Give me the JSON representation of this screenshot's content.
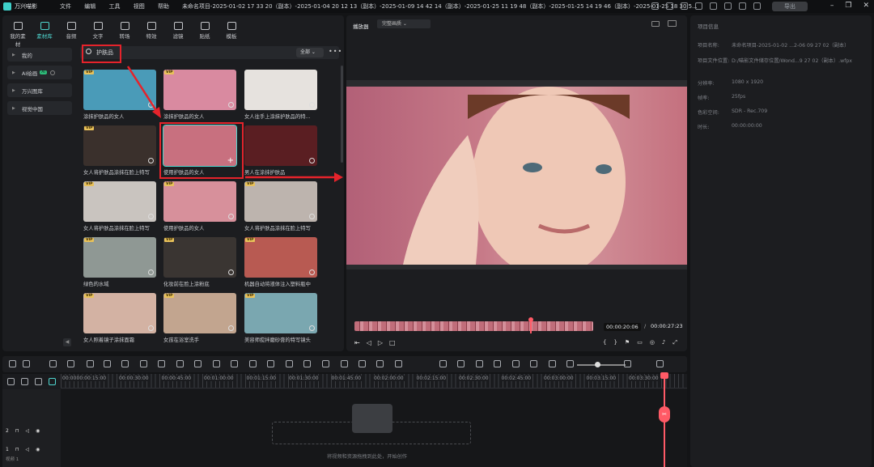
{
  "app": {
    "name": "万兴喵影",
    "menu": [
      "文件",
      "编辑",
      "工具",
      "视图",
      "帮助"
    ],
    "project_title": "未命名项目-2025-01-02 17 33 20（副本）-2025-01-04 20 12 13（副本）-2025-01-09 14 42 14（副本）-2025-01-25 11 19 48（副本）-2025-01-25 14 19 46（副本）-2025-01-25 18 30 5...",
    "export_label": "导出"
  },
  "tabs": [
    {
      "label": "我的素材"
    },
    {
      "label": "素材库"
    },
    {
      "label": "音频"
    },
    {
      "label": "文字"
    },
    {
      "label": "转场"
    },
    {
      "label": "特效"
    },
    {
      "label": "滤镜"
    },
    {
      "label": "贴纸"
    },
    {
      "label": "模板"
    }
  ],
  "sidebar": [
    {
      "label": "我的"
    },
    {
      "label": "AI绘画",
      "badge": "AI"
    },
    {
      "label": "万兴图库"
    },
    {
      "label": "视觉中国"
    }
  ],
  "search": {
    "query": "护肤品",
    "filter": "全部"
  },
  "grid": [
    {
      "caption": "涂抹护肤品的女人",
      "vip": "VIP",
      "color": "#4a9bb8"
    },
    {
      "caption": "涂抹护肤品的女人",
      "vip": "VIP",
      "color": "#d98aa0"
    },
    {
      "caption": "女人往手上涂抹护肤品的特...",
      "vip": "",
      "color": "#e6e2de"
    },
    {
      "caption": "女人将护肤品涂抹在脸上特写",
      "vip": "VIP",
      "color": "#3a302c"
    },
    {
      "caption": "使用护肤品的女人",
      "vip": "",
      "color": "#c8707f"
    },
    {
      "caption": "男人在涂抹护肤品",
      "vip": "",
      "color": "#5a1e22"
    },
    {
      "caption": "女人将护肤品涂抹在脸上特写",
      "vip": "VIP",
      "color": "#c9c4bf"
    },
    {
      "caption": "使用护肤品的女人",
      "vip": "VIP",
      "color": "#d7909b"
    },
    {
      "caption": "女人将护肤品涂抹在脸上特写",
      "vip": "VIP",
      "color": "#bdb4ae"
    },
    {
      "caption": "绿色的水域",
      "vip": "VIP",
      "color": "#8f9894"
    },
    {
      "caption": "化妆前在脸上涂粉底",
      "vip": "VIP",
      "color": "#3a3532"
    },
    {
      "caption": "机器自动将液体注入塑料瓶中",
      "vip": "VIP",
      "color": "#b85a52"
    },
    {
      "caption": "女人照着镜子涂抹面霜",
      "vip": "VIP",
      "color": "#d3b2a3"
    },
    {
      "caption": "女孩在浴室洗手",
      "vip": "VIP",
      "color": "#c2a58f"
    },
    {
      "caption": "美容师搅拌磨砂膏的特写镜头",
      "vip": "VIP",
      "color": "#7aa7b0"
    }
  ],
  "player": {
    "tab": "播放器",
    "quality": "完整画质",
    "current_time": "00:00:20:06",
    "sep": "/",
    "total_time": "00:00:27:23",
    "progress": 0.74
  },
  "props": {
    "title": "项目信息",
    "rows": [
      {
        "k": "项目名称:",
        "v": "未命名项目-2025-01-02 ...2-06 09 27 02（副本）"
      },
      {
        "k": "项目文件位置:",
        "v": "D:/喵影文件储存位置/Wond...9 27 02（副本）.wfpx"
      },
      {
        "k": "分辨率:",
        "v": "1080 x 1920"
      },
      {
        "k": "帧率:",
        "v": "25fps"
      },
      {
        "k": "色彩空间:",
        "v": "SDR - Rec.709"
      },
      {
        "k": "时长:",
        "v": "00:00:00:00"
      }
    ]
  },
  "timeline": {
    "ruler": [
      "00:00",
      "00:00:15:00",
      "00:00:30:00",
      "00:00:45:00",
      "00:01:00:00",
      "00:01:15:00",
      "00:01:30:00",
      "00:01:45:00",
      "00:02:00:00",
      "00:02:15:00",
      "00:02:30:00",
      "00:02:45:00",
      "00:03:00:00",
      "00:03:15:00",
      "00:03:30:00"
    ],
    "tracks": [
      "2",
      "1"
    ],
    "track_label": "视频 1",
    "drop_text": "将视频和资源拖拽到此处，开始创作"
  },
  "colors": {
    "accent": "#4fd6cf",
    "annotation": "#e5232b",
    "playhead": "#ff5a66"
  }
}
